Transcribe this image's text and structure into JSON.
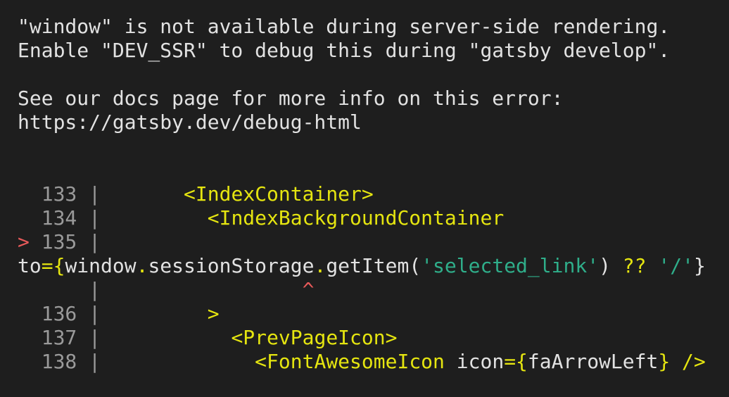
{
  "colors": {
    "background": "#1e1e1e",
    "text": "#e2e2e2",
    "gutter": "#9a9a9a",
    "marker": "#e85a5a",
    "jsx_tag": "#e5e510",
    "string": "#2fae8a"
  },
  "error": {
    "line1": "\"window\" is not available during server-side rendering.",
    "line2": "Enable \"DEV_SSR\" to debug this during \"gatsby develop\".",
    "docs_line": "See our docs page for more info on this error:",
    "docs_url": "https://gatsby.dev/debug-html"
  },
  "code_frame": {
    "pipe": "|",
    "marker": ">",
    "caret": "^",
    "lines": [
      {
        "number": "133",
        "code": "<IndexContainer>"
      },
      {
        "number": "134",
        "code": "<IndexBackgroundContainer"
      },
      {
        "number": "135",
        "code": ""
      },
      {
        "number": "136",
        "code": ">"
      },
      {
        "number": "137",
        "code": "<PrevPageIcon>"
      },
      {
        "number": "138",
        "code": "<FontAwesomeIcon"
      }
    ],
    "wrapped": {
      "prop": "to",
      "eq_brace": "={",
      "obj": "window",
      "dot1": ".",
      "member": "sessionStorage",
      "dot2": ".",
      "method": "getItem(",
      "arg": "'selected_link'",
      "close_paren": ")",
      "nullish": " ?? ",
      "fallback": "'/'",
      "close_brace": "}"
    },
    "icon_prop": {
      "name": " icon",
      "eq_brace": "={",
      "value": "faArrowLeft",
      "close": "} />"
    }
  }
}
